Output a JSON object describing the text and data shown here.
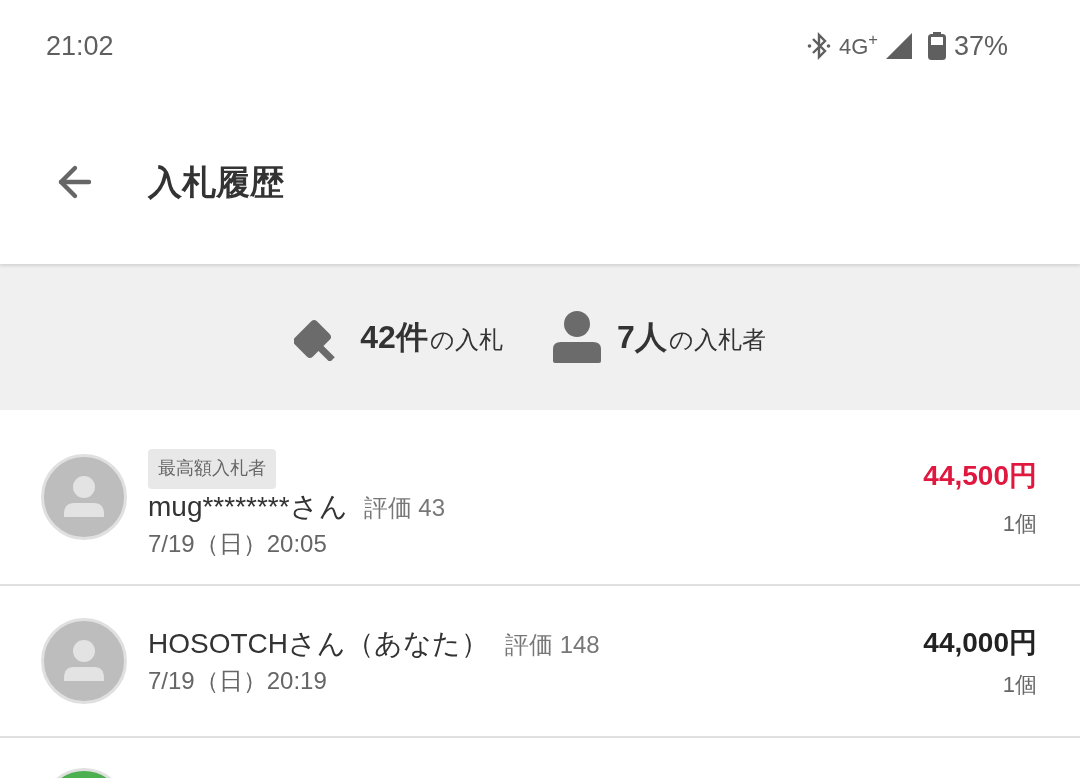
{
  "status_bar": {
    "time": "21:02",
    "network": "4G$^{+}$",
    "battery": "37%"
  },
  "header": {
    "title": "入札履歴"
  },
  "summary": [
    {
      "kind": "bids",
      "count": "42件",
      "label": "の入札"
    },
    {
      "kind": "bidders",
      "count": "7人",
      "label": "の入札者"
    }
  ],
  "bids": [
    {
      "badge": "最高額入札者",
      "name": "mug********さん",
      "rating": "評価 43",
      "date": "7/19（日）20:05",
      "price": "44,500円",
      "quantity": "1個",
      "highest": true,
      "avatar": {
        "color": "#bdbdbd"
      }
    },
    {
      "name": "HOSOTCHさん（あなた）",
      "rating": "評価 148",
      "date": "7/19（日）20:19",
      "price": "44,000円",
      "quantity": "1個",
      "highest": false,
      "avatar": {
        "color": "#bdbdbd"
      }
    }
  ],
  "next_row": {
    "avatar": {
      "color": "#4caf50"
    }
  }
}
